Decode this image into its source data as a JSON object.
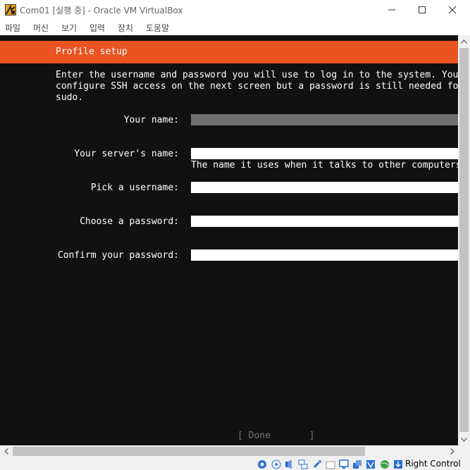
{
  "window": {
    "title": "Com01 [실행 중] - Oracle VM VirtualBox"
  },
  "menu": {
    "items": [
      "파일",
      "머신",
      "보기",
      "입력",
      "장치",
      "도움말"
    ]
  },
  "installer": {
    "header_title": "Profile setup",
    "description": "Enter the username and password you will use to log in to the system. You can\nconfigure SSH access on the next screen but a password is still needed for\nsudo.",
    "fields": {
      "name": {
        "label": "Your name:",
        "value": ""
      },
      "server_name": {
        "label": "Your server's name:",
        "value": "",
        "help": "The name it uses when it talks to other computers."
      },
      "username": {
        "label": "Pick a username:",
        "value": ""
      },
      "password": {
        "label": "Choose a password:",
        "value": ""
      },
      "confirm_password": {
        "label": "Confirm your password:",
        "value": ""
      }
    },
    "done_label": "[ Done       ]"
  },
  "statusbar": {
    "host_key": "Right Control"
  },
  "colors": {
    "accent": "#e95420",
    "terminal_bg": "#111111",
    "active_field": "#6f6f6f"
  }
}
